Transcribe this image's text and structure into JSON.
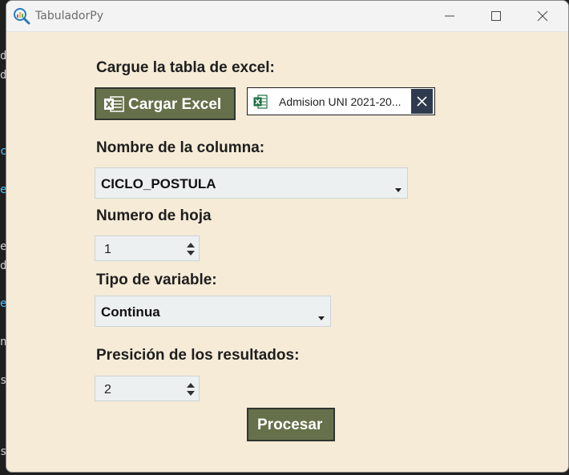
{
  "window": {
    "title": "TabuladorPy",
    "controls": [
      "minimize",
      "maximize",
      "close"
    ]
  },
  "colors": {
    "content_bg": "#f5ebd7",
    "titlebar_bg": "#f3f3f3",
    "button_bg": "#66704a",
    "button_border": "#2f3630",
    "input_bg": "#edf0f0",
    "chip_close_bg": "#2e3b4e",
    "excel_green": "#1d6f42"
  },
  "form": {
    "upload_label": "Cargue la tabla de excel:",
    "upload_button": "Cargar Excel",
    "file_name": "Admision UNI 2021-20...",
    "column_label": "Nombre de la columna:",
    "column_value": "CICLO_POSTULA",
    "sheet_label": "Numero de hoja",
    "sheet_value": "1",
    "var_type_label": "Tipo de variable:",
    "var_type_value": "Continua",
    "precision_label": "Presición de los resultados:",
    "precision_value": "2",
    "process_button": "Procesar"
  },
  "icons": {
    "app": "magnifier-chart-icon",
    "upload": "excel-icon",
    "file": "excel-icon",
    "remove": "close-icon"
  }
}
